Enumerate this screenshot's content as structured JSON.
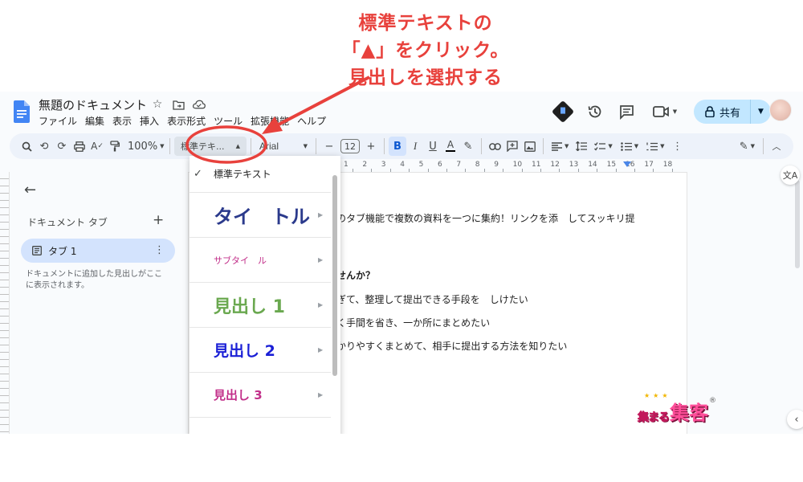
{
  "annotation": {
    "lines": [
      "標準テキストの",
      "「▲」をクリック。",
      "見出しを選択する"
    ],
    "color": "#e8413c"
  },
  "header": {
    "title": "無題のドキュメント",
    "menu": [
      "ファイル",
      "編集",
      "表示",
      "挿入",
      "表示形式",
      "ツール",
      "拡張機能",
      "ヘルプ"
    ],
    "share_label": "共有",
    "icons": [
      "star-icon",
      "move-folder-icon",
      "cloud-status-icon",
      "gemini-icon",
      "history-icon",
      "comment-icon",
      "meet-icon",
      "lock-icon"
    ]
  },
  "toolbar": {
    "zoom": "100%",
    "style": "標準テキ...",
    "font": "Arial",
    "minus": "−",
    "font_size": "12",
    "plus": "+",
    "bold": "B",
    "italic": "I",
    "underline": "U",
    "text_color": "A"
  },
  "ruler": {
    "ticks": [
      "1",
      "2",
      "3",
      "4",
      "5",
      "6",
      "7",
      "8",
      "9",
      "10",
      "11",
      "12",
      "13",
      "14",
      "15",
      "16",
      "17",
      "18"
    ]
  },
  "left_panel": {
    "tabs_heading": "ドキュメント タブ",
    "tab_name": "タブ 1",
    "hint": "ドキュメントに追加した見出しがここに表示されます。"
  },
  "document": {
    "lines": [
      "のタブ機能で複数の資料を一つに集約！リンクを添　してスッキリ提",
      "せんか？",
      "ぎて、整理して提出できる手段を　しけたい",
      "く手間を省き、一か所にまとめたい",
      "かりやすくまとめて、相手に提出する方法を知りたい"
    ]
  },
  "style_menu": {
    "items": [
      {
        "label": "標準テキスト",
        "checked": true,
        "color": "#1f1f1f"
      },
      {
        "label": "タイ　トル",
        "color": "#2b3a8c"
      },
      {
        "label": "サブタイ　ル",
        "color": "#c2308a"
      },
      {
        "label": "見出し 1",
        "color": "#6aa84f"
      },
      {
        "label": "見出し 2",
        "color": "#1a1fd6"
      },
      {
        "label": "見出し 3",
        "color": "#c2308a"
      }
    ]
  },
  "logo": {
    "small": "集まる",
    "big": "集客",
    "reg": "®",
    "stars": "★★★"
  }
}
